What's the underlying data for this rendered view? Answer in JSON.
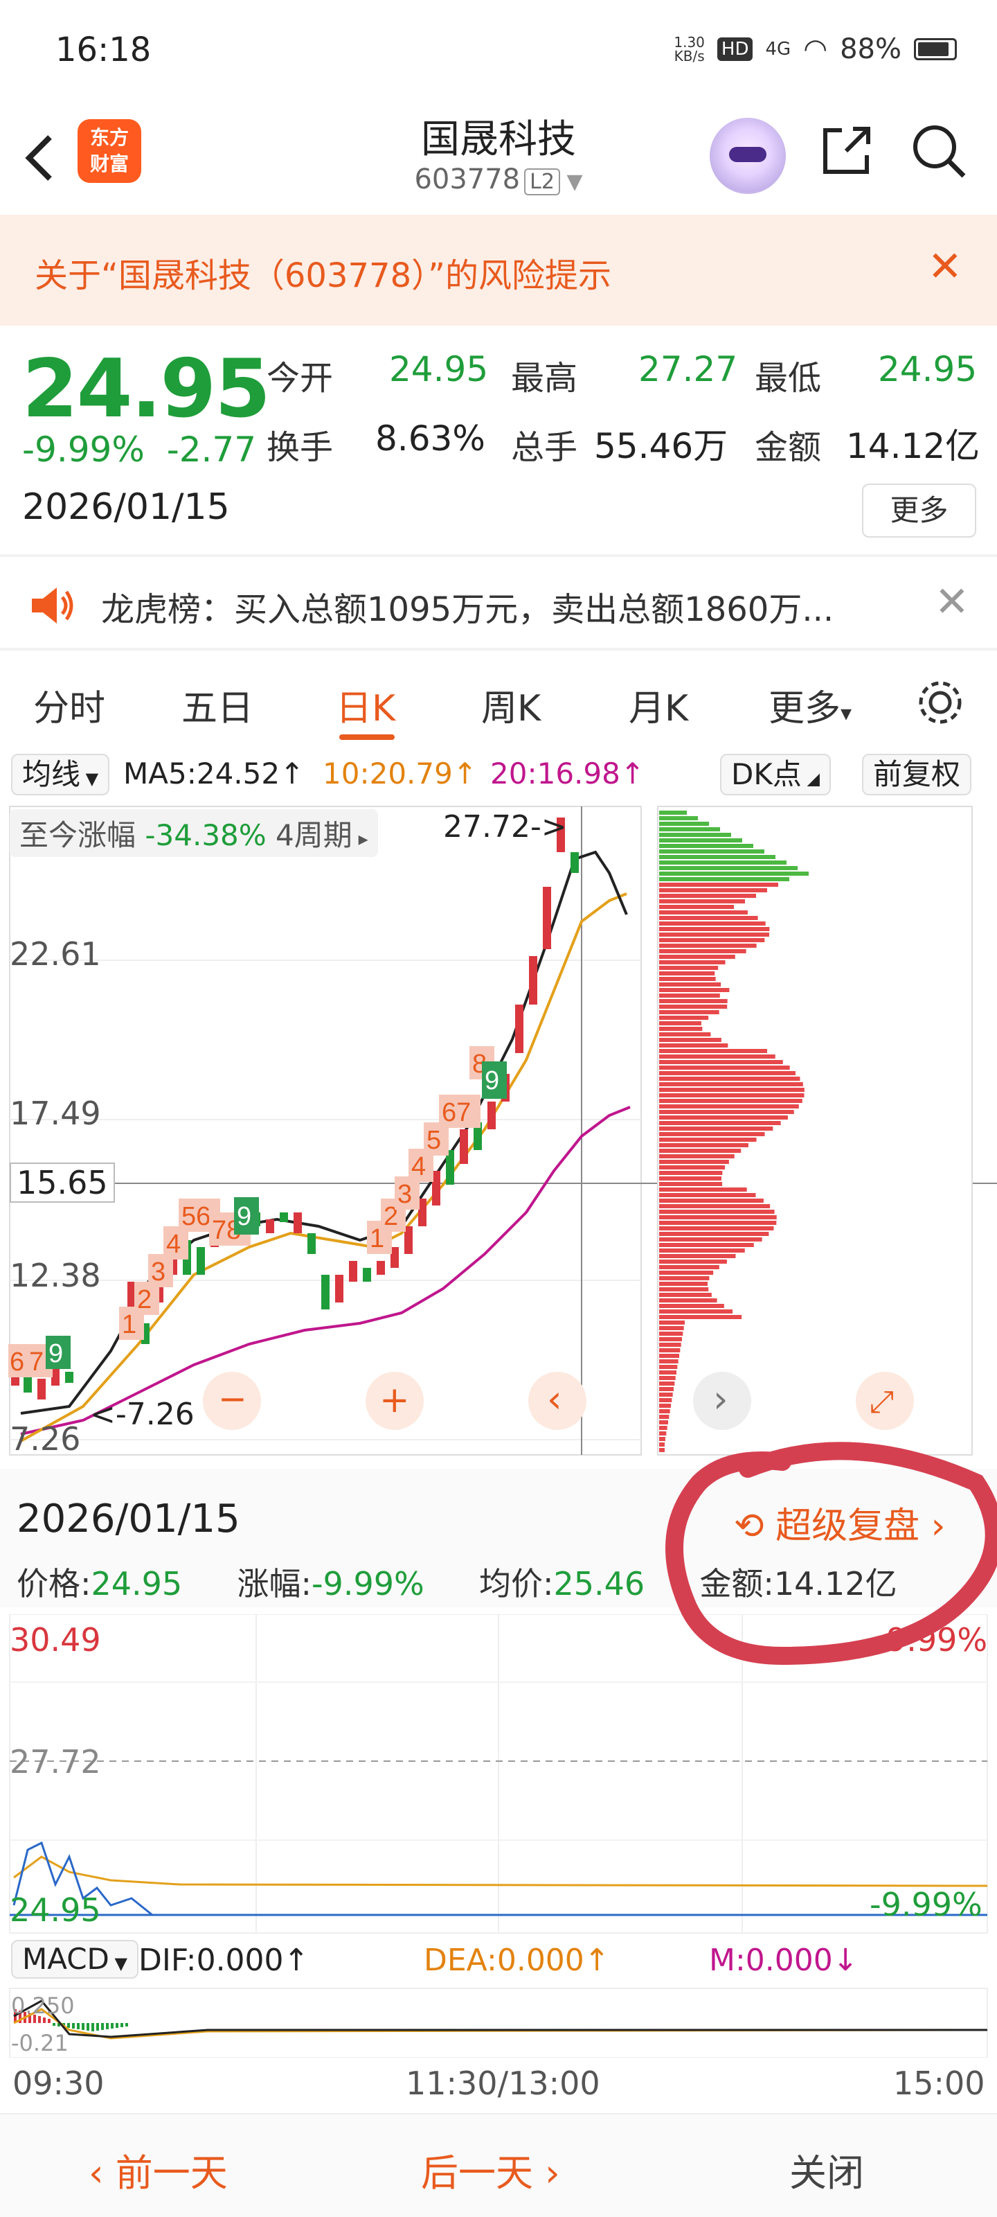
{
  "status": {
    "time": "16:18",
    "net_top": "1.30",
    "net_bottom": "KB/s",
    "hd": "HD",
    "signal": "4G",
    "battery": "88%"
  },
  "header": {
    "logo_line1": "东方",
    "logo_line2": "财富",
    "title": "国晟科技",
    "code": "603778",
    "level": "L2"
  },
  "risk": {
    "text": "关于“国晟科技（603778）”的风险提示",
    "close": "✕"
  },
  "quote": {
    "price": "24.95",
    "change_pct": "-9.99%",
    "change_amt": "-2.77",
    "date": "2026/01/15",
    "open_label": "今开",
    "open": "24.95",
    "high_label": "最高",
    "high": "27.27",
    "low_label": "最低",
    "low": "24.95",
    "turnover_label": "换手",
    "turnover": "8.63%",
    "volume_label": "总手",
    "volume": "55.46万",
    "amount_label": "金额",
    "amount": "14.12亿",
    "more": "更多"
  },
  "lhb": {
    "text": "龙虎榜：买入总额1095万元，卖出总额1860万...",
    "close": "✕"
  },
  "tabs": {
    "t1": "分时",
    "t2": "五日",
    "t3": "日K",
    "t4": "周K",
    "t5": "月K",
    "t6": "更多",
    "t6_arrow": "▾"
  },
  "ma": {
    "selector": "均线",
    "ma5": "MA5:24.52",
    "ma10": "10:20.79",
    "ma20": "20:16.98",
    "arrow": "↑",
    "dk": "DK点",
    "fq": "前复权"
  },
  "kchart": {
    "period_label": "至今涨幅",
    "period_pct": "-34.38%",
    "period_text": "4周期",
    "peak_label": "27.72->",
    "low_label": "<-7.26",
    "y_labels": [
      "22.61",
      "17.49",
      "12.38",
      "7.26"
    ],
    "crosshair_price": "15.65",
    "controls": {
      "zoom_out": "−",
      "zoom_in": "+",
      "prev": "‹",
      "next": "›",
      "expand": "⤢"
    }
  },
  "detail": {
    "date": "2026/01/15",
    "super": "超级复盘",
    "price_label": "价格:",
    "price": "24.95",
    "chg_label": "涨幅:",
    "chg": "-9.99%",
    "avg_label": "均价:",
    "avg": "25.46",
    "amt_label": "金额:",
    "amt": "14.12亿"
  },
  "intraday": {
    "y_top": "30.49",
    "y_mid": "27.72",
    "y_bot": "24.95",
    "pct_top": "9.99%",
    "pct_bot": "-9.99%"
  },
  "macd": {
    "selector": "MACD",
    "dif": "DIF:0.000",
    "dea": "DEA:0.000",
    "m": "M:0.000",
    "up": "↑",
    "down": "↓",
    "y_top": "0.250",
    "y_bot": "-0.21"
  },
  "time_axis": {
    "start": "09:30",
    "mid": "11:30/13:00",
    "end": "15:00"
  },
  "bottom": {
    "prev": "前一天",
    "next": "后一天",
    "close": "关闭"
  },
  "colors": {
    "up": "#d9363e",
    "down": "#1f9d3a",
    "accent": "#e85a1e",
    "ma5": "#222222",
    "ma10": "#e3a01a",
    "ma20": "#c0168d"
  }
}
